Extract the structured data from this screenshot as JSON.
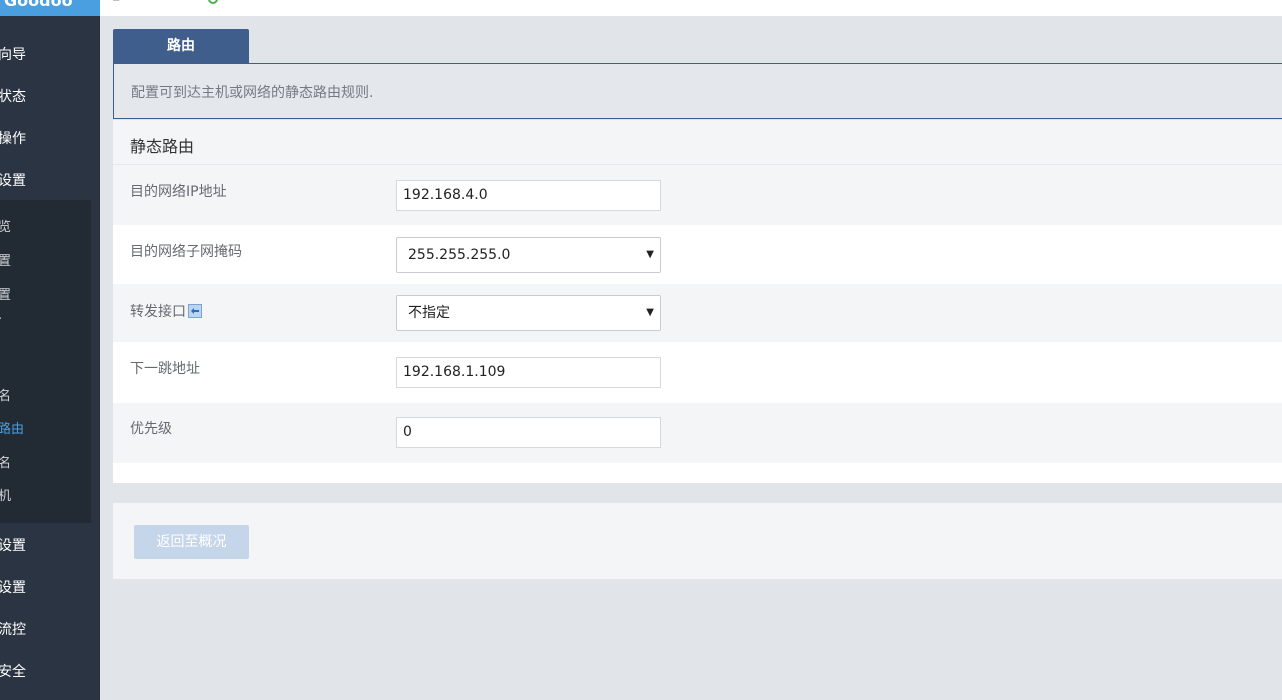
{
  "sidebar": {
    "logo": "Goodoo",
    "items_top": [
      {
        "label": "向导"
      },
      {
        "label": "状态"
      },
      {
        "label": "操作"
      },
      {
        "label": "设置"
      }
    ],
    "submenu": [
      {
        "label": "览"
      },
      {
        "label": "置"
      },
      {
        "label": "置"
      },
      {
        "label": "·"
      },
      {
        "label": "名"
      },
      {
        "label": "路由"
      },
      {
        "label": "名"
      },
      {
        "label": "机"
      }
    ],
    "items_bottom": [
      {
        "label": "设置"
      },
      {
        "label": "设置"
      },
      {
        "label": "流控"
      },
      {
        "label": "安全"
      }
    ]
  },
  "tab": {
    "label": "路由"
  },
  "description": "配置可到达主机或网络的静态路由规则.",
  "section": {
    "title": "静态路由",
    "fields": {
      "dest_ip": {
        "label": "目的网络IP地址",
        "value": "192.168.4.0"
      },
      "netmask": {
        "label": "目的网络子网掩码",
        "value": "255.255.255.0"
      },
      "interface": {
        "label": "转发接口",
        "value": "不指定"
      },
      "next_hop": {
        "label": "下一跳地址",
        "value": "192.168.1.109"
      },
      "priority": {
        "label": "优先级",
        "value": "0"
      }
    }
  },
  "footer": {
    "back_label": "返回至概况"
  },
  "colors": {
    "accent": "#3f5e8c",
    "sidebar_bg": "#2b3442",
    "active_link": "#4a9fe0"
  }
}
